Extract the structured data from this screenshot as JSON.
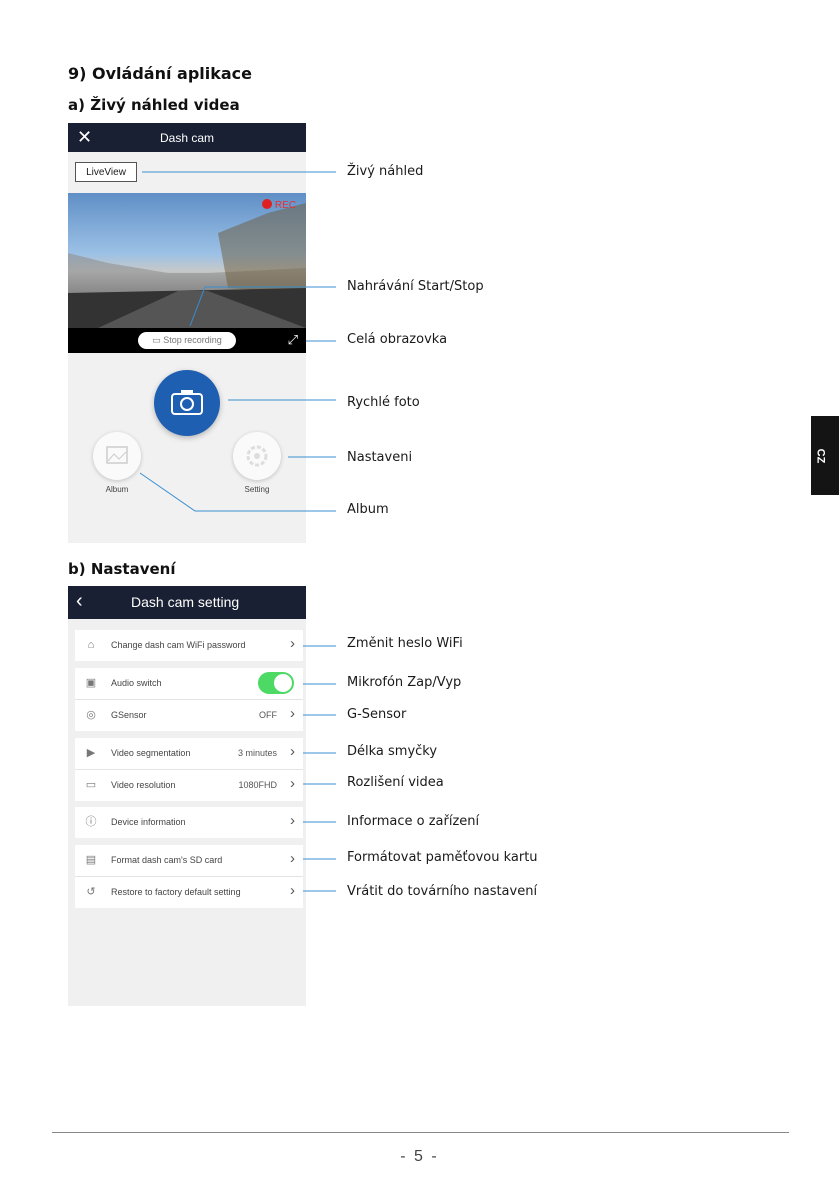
{
  "headings": {
    "main": "9) Ovládání aplikace",
    "live": "a) Živý náhled videa",
    "settings": "b) Nastavení"
  },
  "live_screen": {
    "close_icon": "close-icon",
    "title": "Dash cam",
    "liveview_button": "LiveView",
    "rec_label": "REC",
    "stop_recording": "Stop recording",
    "album_label": "Album",
    "setting_label": "Setting"
  },
  "settings_screen": {
    "back_icon": "chevron-left-icon",
    "title": "Dash cam setting",
    "rows": {
      "wifi": {
        "label": "Change dash cam WiFi password"
      },
      "audio": {
        "label": "Audio switch",
        "on": true
      },
      "gsensor": {
        "label": "GSensor",
        "value": "OFF"
      },
      "segmentation": {
        "label": "Video segmentation",
        "value": "3 minutes"
      },
      "resolution": {
        "label": "Video resolution",
        "value": "1080FHD"
      },
      "device": {
        "label": "Device information"
      },
      "format": {
        "label": "Format dash cam's SD card"
      },
      "restore": {
        "label": "Restore to factory default setting"
      }
    }
  },
  "callouts": {
    "live": "Živý náhled",
    "record": "Nahrávání Start/Stop",
    "fullscreen": "Celá obrazovka",
    "photo": "Rychlé foto",
    "settings": "Nastaveni",
    "album": "Album",
    "wifi": "Změnit heslo WiFi",
    "mic": "Mikrofón Zap/Vyp",
    "gsensor": "G-Sensor",
    "loop": "Délka smyčky",
    "resolution": "Rozlišení videa",
    "device": "Informace o zařízení",
    "format": "Formátovat paměťovou kartu",
    "restore": "Vrátit do továrního nastavení"
  },
  "side_tab": "CZ",
  "page_number": "- 5 -",
  "colors": {
    "leader": "#3a8fd0",
    "topbar": "#1a2033",
    "camera_button": "#1f5fb2",
    "toggle_on": "#4cd964",
    "rec": "#e02020"
  }
}
